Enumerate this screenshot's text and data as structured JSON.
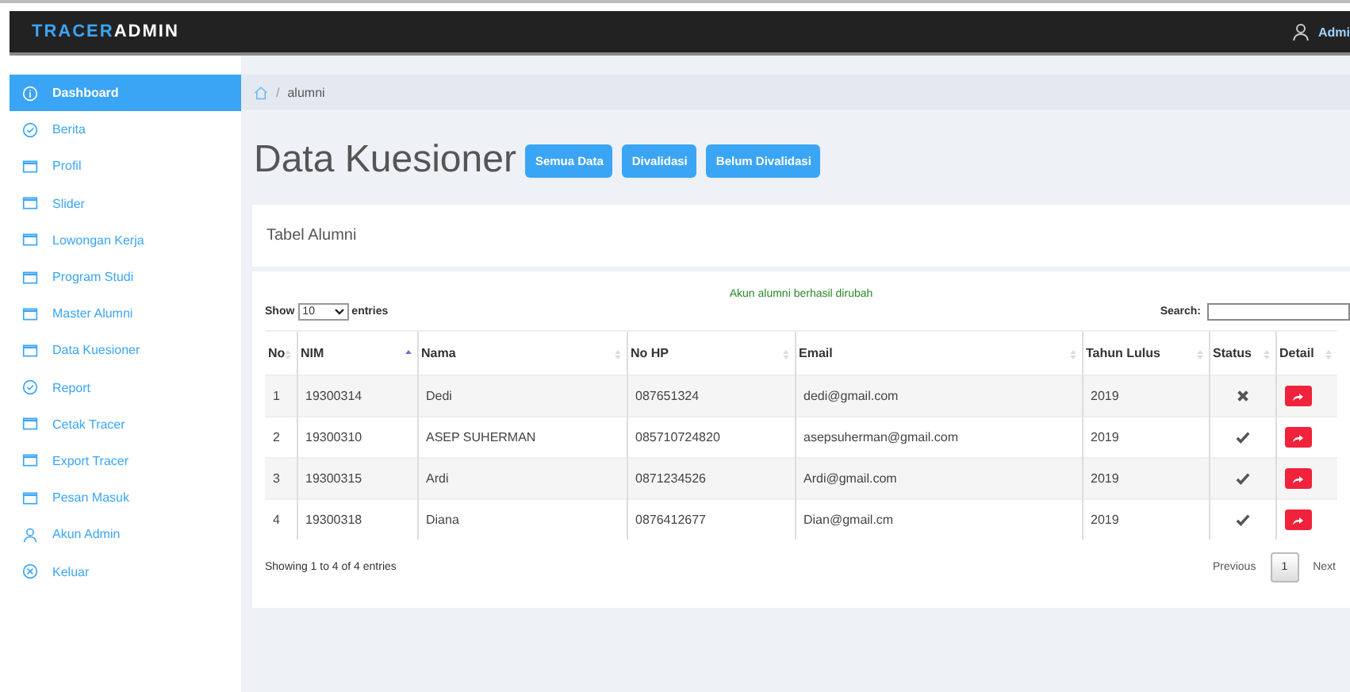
{
  "topbar": {
    "brand_part1": "TRACER",
    "brand_part2": "ADMIN",
    "user": "Admi"
  },
  "sidebar": {
    "items": [
      {
        "label": "Dashboard",
        "kind": "info",
        "selected": true
      },
      {
        "label": "Berita",
        "kind": "check",
        "selected": false
      },
      {
        "label": "Profil",
        "kind": "window",
        "selected": false
      },
      {
        "label": "Slider",
        "kind": "window",
        "selected": false
      },
      {
        "label": "Lowongan Kerja",
        "kind": "window",
        "selected": false
      },
      {
        "label": "Program Studi",
        "kind": "window",
        "selected": false
      },
      {
        "label": "Master Alumni",
        "kind": "window",
        "selected": false
      },
      {
        "label": "Data Kuesioner",
        "kind": "window",
        "selected": false
      },
      {
        "label": "Report",
        "kind": "check",
        "selected": false
      },
      {
        "label": "Cetak Tracer",
        "kind": "window",
        "selected": false
      },
      {
        "label": "Export Tracer",
        "kind": "window",
        "selected": false
      },
      {
        "label": "Pesan Masuk",
        "kind": "window",
        "selected": false
      },
      {
        "label": "Akun Admin",
        "kind": "user",
        "selected": false
      },
      {
        "label": "Keluar",
        "kind": "close",
        "selected": false
      }
    ]
  },
  "breadcrumb": {
    "separator": "/",
    "current": "alumni"
  },
  "page_title": "Data Kuesioner",
  "filter_buttons": [
    "Semua Data",
    "Divalidasi",
    "Belum Divalidasi"
  ],
  "card": {
    "title": "Tabel Alumni",
    "message": "Akun alumni berhasil dirubah",
    "length": {
      "before": "Show",
      "value": "10",
      "after": "entries"
    },
    "search_label": "Search:",
    "table": {
      "columns": [
        {
          "label": "No",
          "sorted": false
        },
        {
          "label": "NIM",
          "sorted": true
        },
        {
          "label": "Nama",
          "sorted": false
        },
        {
          "label": "No HP",
          "sorted": false
        },
        {
          "label": "Email",
          "sorted": false
        },
        {
          "label": "Tahun Lulus",
          "sorted": false
        },
        {
          "label": "Status",
          "sorted": false
        },
        {
          "label": "Detail",
          "sorted": false
        }
      ],
      "rows": [
        {
          "no": "1",
          "nim": "19300314",
          "nama": "Dedi",
          "hp": "087651324",
          "email": "dedi@gmail.com",
          "tahun": "2019",
          "validated": false
        },
        {
          "no": "2",
          "nim": "19300310",
          "nama": "ASEP SUHERMAN",
          "hp": "085710724820",
          "email": "asepsuherman@gmail.com",
          "tahun": "2019",
          "validated": true
        },
        {
          "no": "3",
          "nim": "19300315",
          "nama": "Ardi",
          "hp": "0871234526",
          "email": "Ardi@gmail.com",
          "tahun": "2019",
          "validated": true
        },
        {
          "no": "4",
          "nim": "19300318",
          "nama": "Diana",
          "hp": "0876412677",
          "email": "Dian@gmail.cm",
          "tahun": "2019",
          "validated": true
        }
      ]
    },
    "info": "Showing 1 to 4 of 4 entries",
    "pagination": [
      {
        "label": "Previous",
        "selected": false
      },
      {
        "label": "1",
        "selected": true
      },
      {
        "label": "Next",
        "selected": false
      }
    ]
  }
}
